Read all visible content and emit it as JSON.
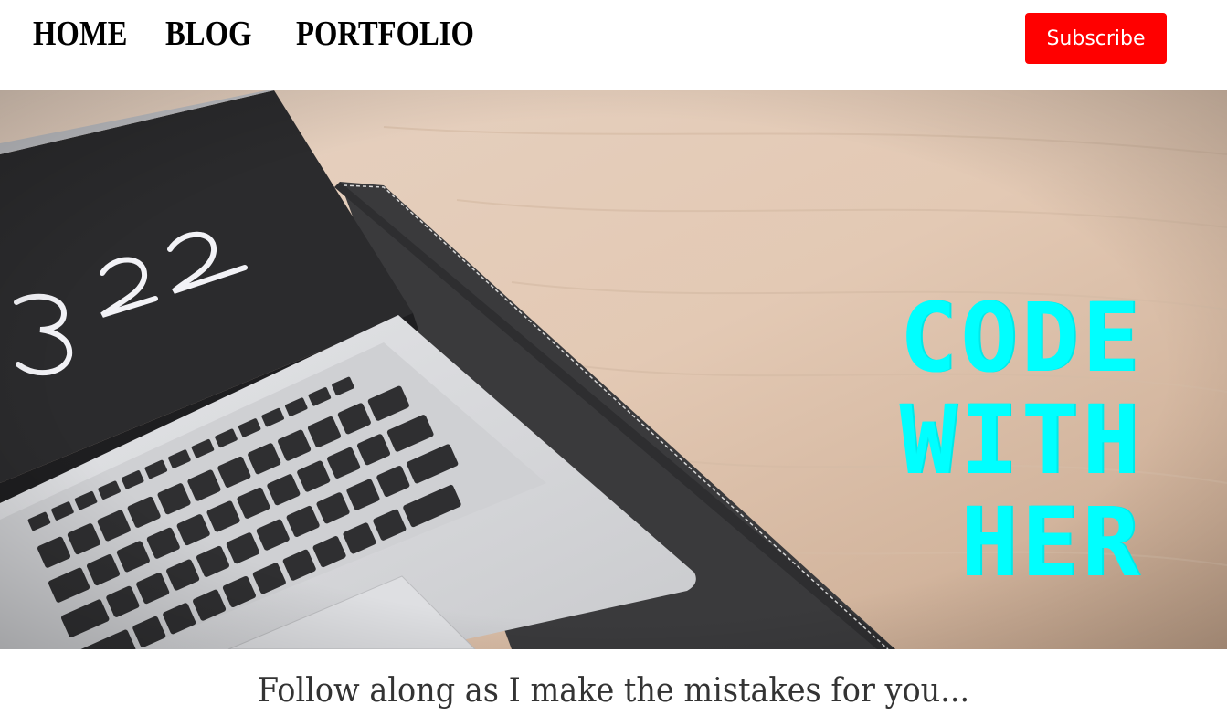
{
  "nav": {
    "items": [
      {
        "label": "HOME"
      },
      {
        "label": "BLOG"
      },
      {
        "label": "PORTFOLIO"
      }
    ],
    "subscribe_label": "Subscribe"
  },
  "hero": {
    "title_lines": [
      "CODE",
      "WITH",
      "HER"
    ],
    "clock_text": "3 22",
    "title_color": "#00ffff"
  },
  "tagline": "Follow along as I make the mistakes for you...",
  "colors": {
    "subscribe_bg": "#ff0000",
    "tagline": "#333333"
  }
}
